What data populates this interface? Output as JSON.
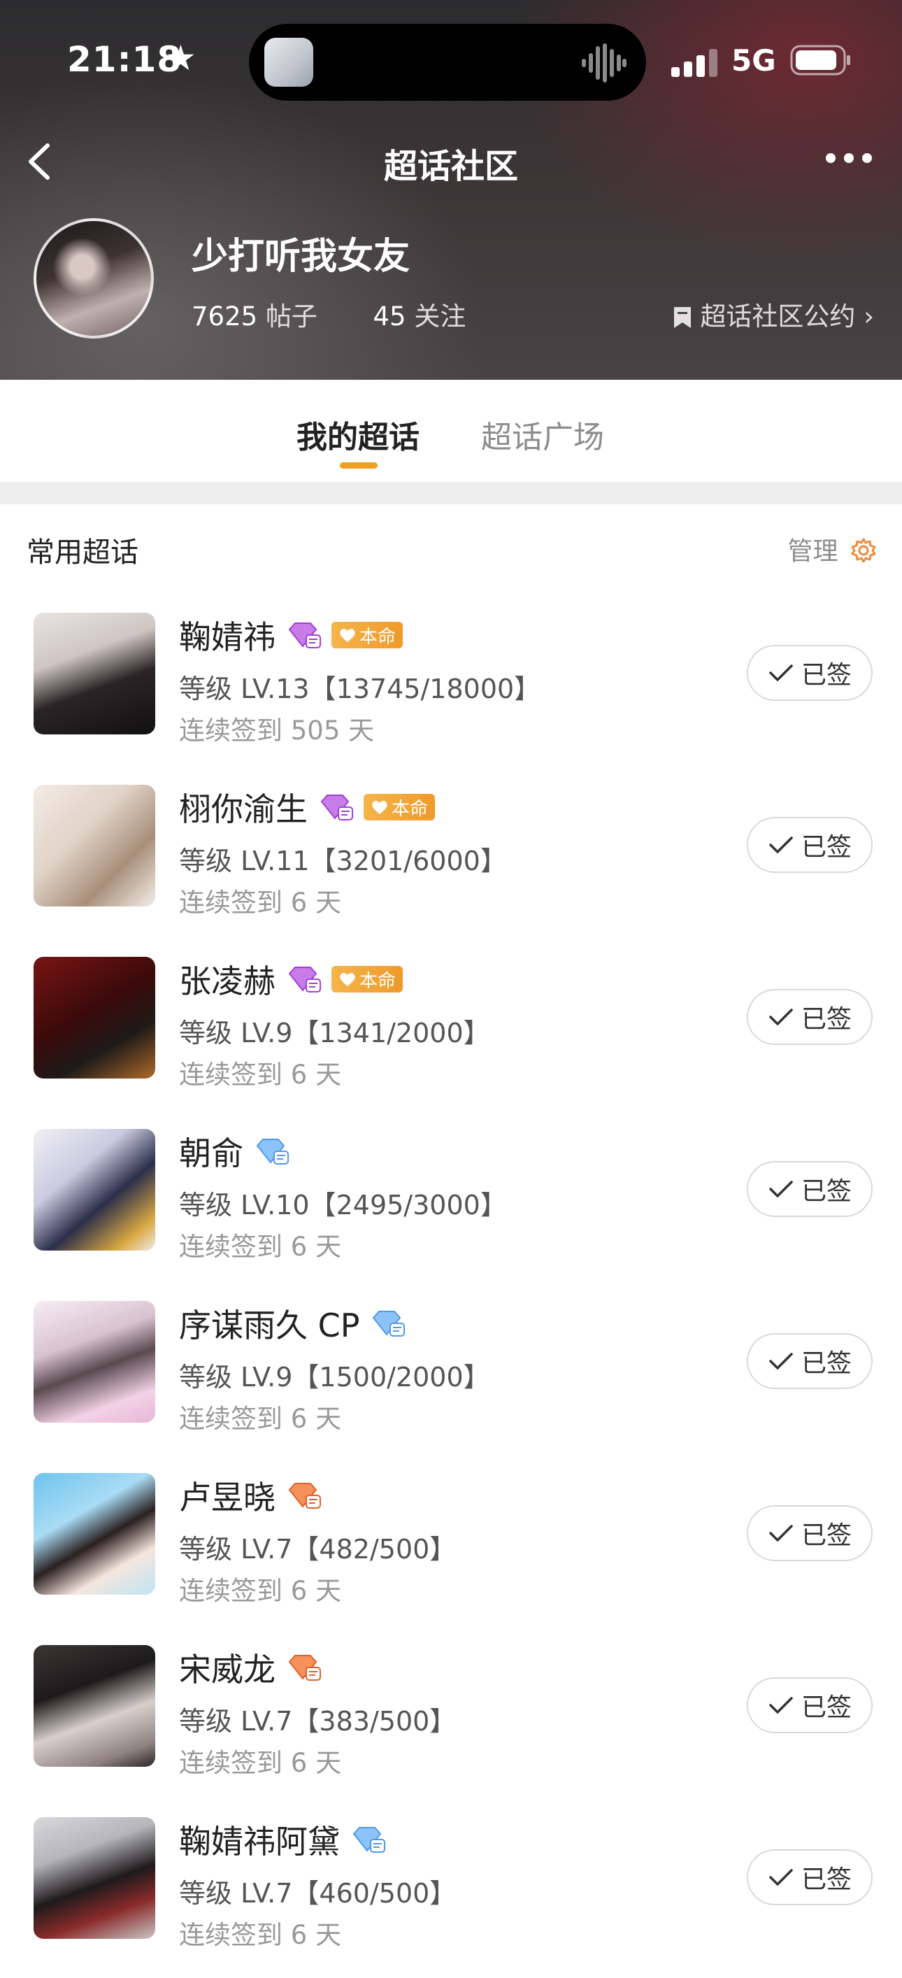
{
  "status_bar": {
    "time": "21:18",
    "network": "5G"
  },
  "nav": {
    "title": "超话社区"
  },
  "profile": {
    "username": "少打听我女友",
    "posts_count": "7625",
    "posts_label": "帖子",
    "following_count": "45",
    "following_label": "关注",
    "rules_link": "超话社区公约"
  },
  "tabs": [
    {
      "label": "我的超话",
      "active": true
    },
    {
      "label": "超话广场",
      "active": false
    }
  ],
  "section": {
    "title": "常用超话",
    "manage_label": "管理"
  },
  "benming_label": "本命",
  "signed_label": "已签",
  "items": [
    {
      "name": "鞠婧祎",
      "badge": "purple-diamond",
      "benming": true,
      "level": "等级 LV.13【13745/18000】",
      "streak": "连续签到 505 天"
    },
    {
      "name": "栩你渝生",
      "badge": "purple-diamond",
      "benming": true,
      "level": "等级 LV.11【3201/6000】",
      "streak": "连续签到 6 天"
    },
    {
      "name": "张凌赫",
      "badge": "purple-diamond",
      "benming": true,
      "level": "等级 LV.9【1341/2000】",
      "streak": "连续签到 6 天"
    },
    {
      "name": "朝俞",
      "badge": "blue-diamond",
      "benming": false,
      "level": "等级 LV.10【2495/3000】",
      "streak": "连续签到 6 天"
    },
    {
      "name": "序谋雨久 CP",
      "badge": "blue-diamond",
      "benming": false,
      "level": "等级 LV.9【1500/2000】",
      "streak": "连续签到 6 天"
    },
    {
      "name": "卢昱晓",
      "badge": "orange-diamond",
      "benming": false,
      "level": "等级 LV.7【482/500】",
      "streak": "连续签到 6 天"
    },
    {
      "name": "宋威龙",
      "badge": "orange-diamond",
      "benming": false,
      "level": "等级 LV.7【383/500】",
      "streak": "连续签到 6 天"
    },
    {
      "name": "鞠婧祎阿黛",
      "badge": "blue-diamond",
      "benming": false,
      "level": "等级 LV.7【460/500】",
      "streak": "连续签到 6 天"
    }
  ],
  "colors": {
    "accent": "#f0a020",
    "purple_badge": "#b84fe0",
    "blue_badge": "#5aa7f5",
    "orange_badge": "#f06b2a"
  }
}
